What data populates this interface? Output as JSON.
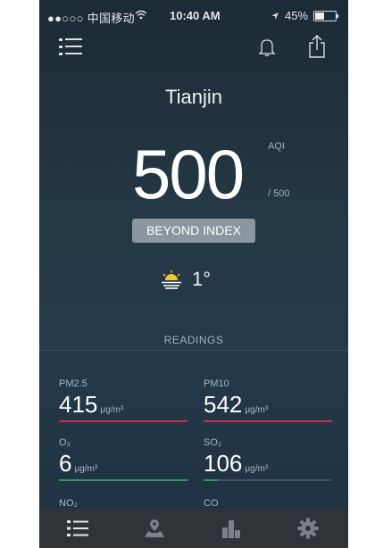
{
  "status_bar": {
    "carrier": "●●○○○ 中国移动",
    "time": "10:40 AM",
    "battery": "45%",
    "battery_level": 0.45,
    "icons": [
      "wifi-icon",
      "location-arrow-icon",
      "battery-icon"
    ]
  },
  "header": {
    "icons": [
      "list-icon",
      "bell-icon",
      "share-icon"
    ]
  },
  "main": {
    "city": "Tianjin",
    "aqi_value": "500",
    "aqi_label": "AQI",
    "aqi_max": "/ 500",
    "status_badge": "BEYOND INDEX",
    "weather_icon": "sun-haze-icon",
    "temperature": "1°"
  },
  "readings": {
    "title": "READINGS",
    "items": [
      {
        "name": "PM2.5",
        "value": "415",
        "unit": "μg/m³",
        "level": 1.0,
        "color": "#c2304a"
      },
      {
        "name": "PM10",
        "value": "542",
        "unit": "μg/m³",
        "level": 1.0,
        "color": "#c2304a"
      },
      {
        "name": "O₃",
        "value": "6",
        "unit": "μg/m³",
        "level": 1.0,
        "color": "#2e9a5a"
      },
      {
        "name": "SO₂",
        "value": "106",
        "unit": "μg/m³",
        "level": 0.12,
        "color": "#2e9a5a"
      },
      {
        "name": "NO₂",
        "value": "",
        "unit": ""
      },
      {
        "name": "CO",
        "value": "",
        "unit": ""
      }
    ]
  },
  "tabbar": {
    "icons": [
      "list-icon",
      "map-icon",
      "ranking-icon",
      "gear-icon"
    ],
    "active_color": "#e8e8e8",
    "inactive_color": "#7c8388"
  }
}
